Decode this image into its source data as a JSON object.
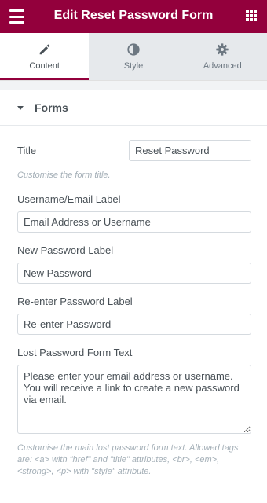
{
  "header": {
    "title": "Edit Reset Password Form",
    "menu_icon": "hamburger-menu-icon",
    "apps_icon": "grid-apps-icon",
    "color": "#93003c"
  },
  "tabs": [
    {
      "label": "Content",
      "icon": "pencil-icon",
      "active": true
    },
    {
      "label": "Style",
      "icon": "half-circle-contrast-icon",
      "active": false
    },
    {
      "label": "Advanced",
      "icon": "gear-icon",
      "active": false
    }
  ],
  "section": {
    "title": "Forms",
    "expanded": true
  },
  "fields": {
    "title": {
      "label": "Title",
      "value": "Reset Password",
      "description": "Customise the form title."
    },
    "username_label": {
      "label": "Username/Email Label",
      "value": "Email Address or Username"
    },
    "new_password_label": {
      "label": "New Password Label",
      "value": "New Password"
    },
    "reenter_password_label": {
      "label": "Re-enter Password Label",
      "value": "Re-enter Password"
    },
    "lost_password_text": {
      "label": "Lost Password Form Text",
      "value": "Please enter your email address or username. You will receive a link to create a new password via email.",
      "description": "Customise the main lost password form text. Allowed tags are: <a> with \"href\" and \"title\" attributes, <br>, <em>, <strong>, <p> with \"style\" attribute."
    }
  }
}
